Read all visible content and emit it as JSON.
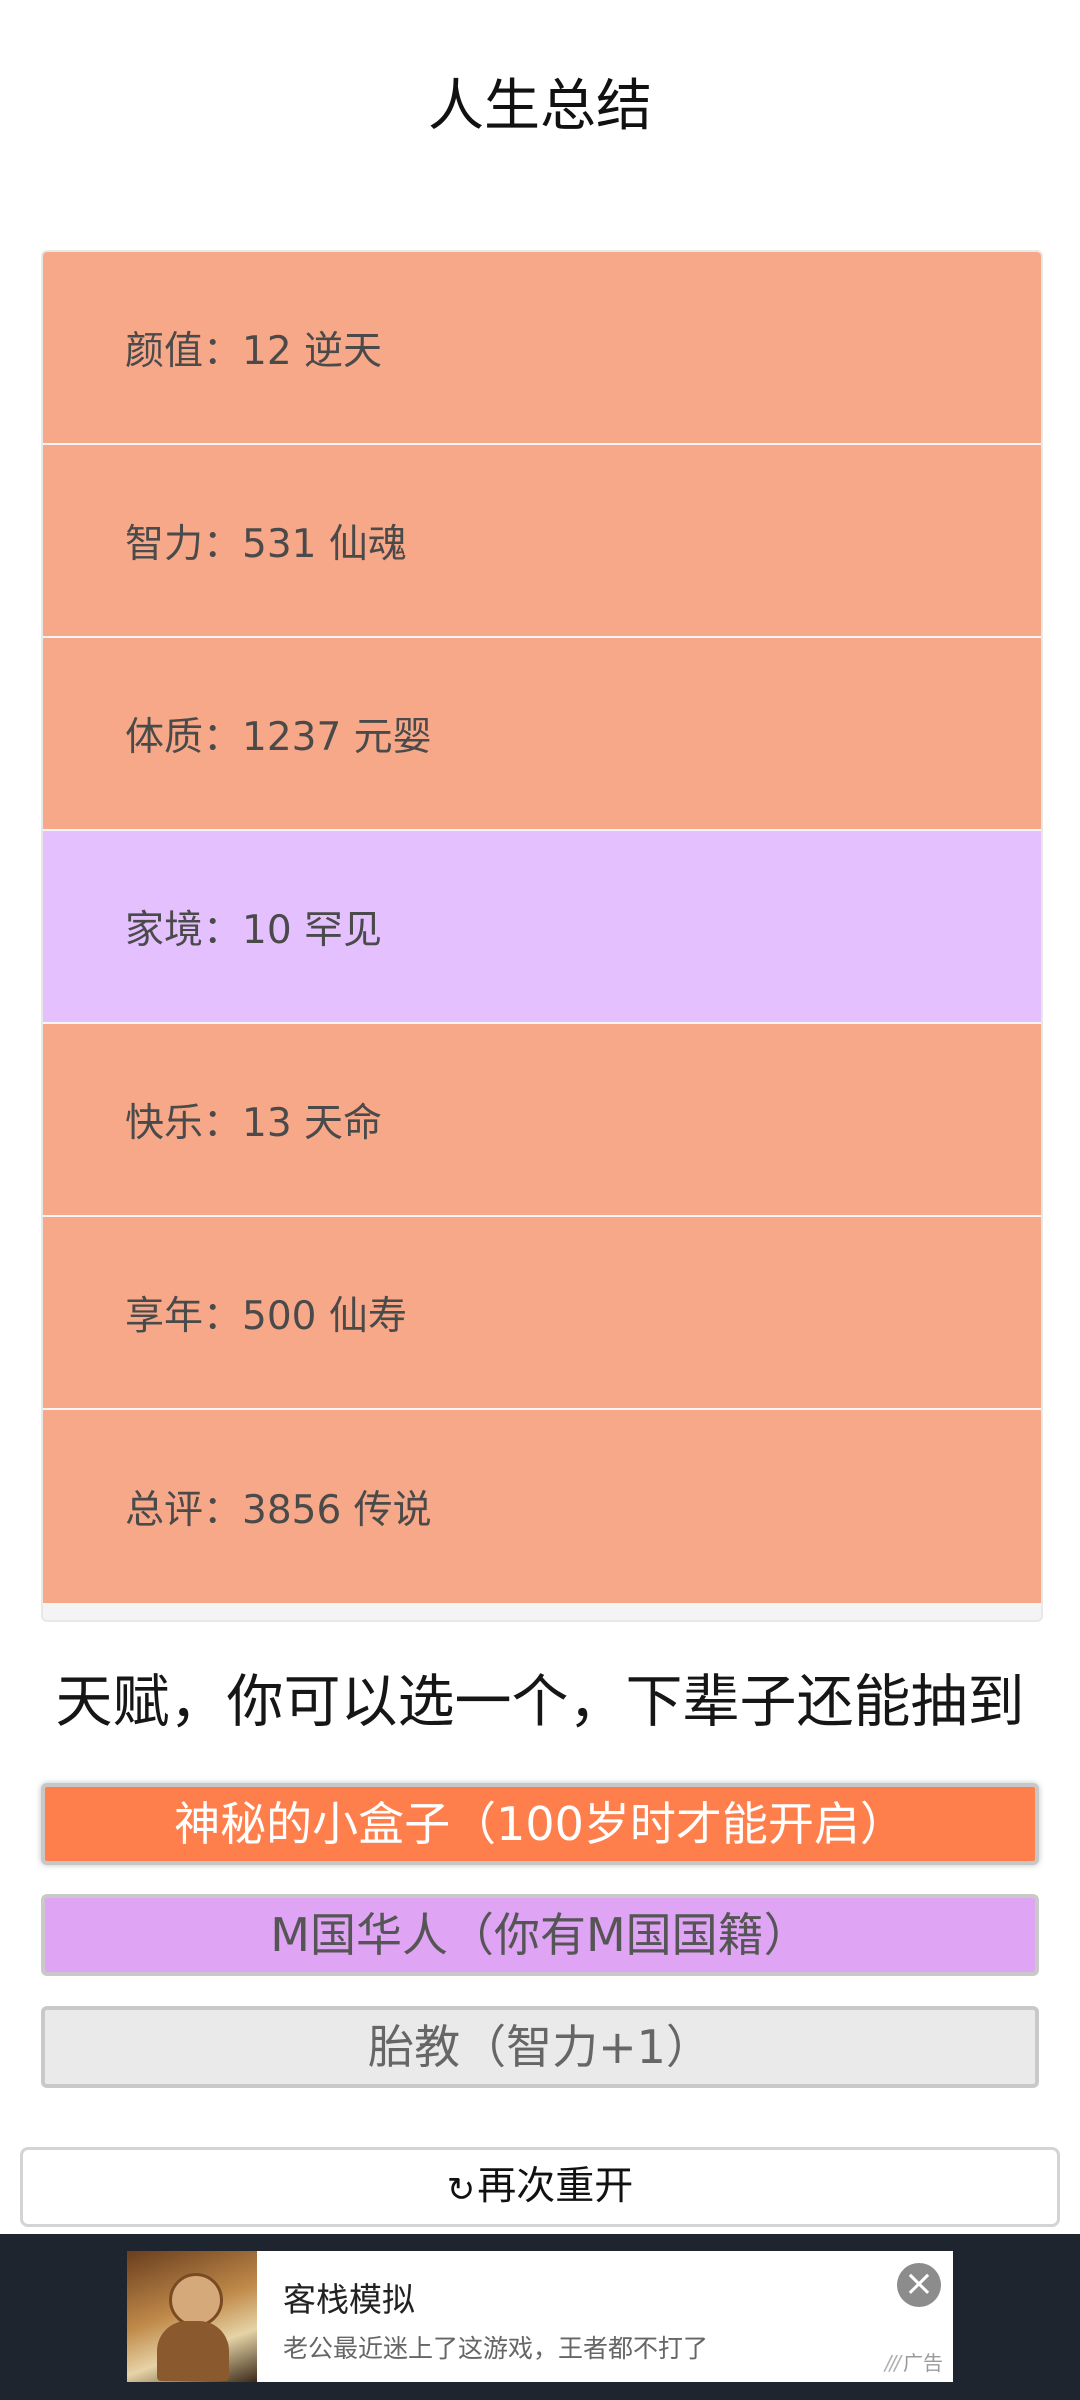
{
  "page": {
    "title": "人生总结"
  },
  "summary": {
    "rows": [
      {
        "label": "颜值：12 逆天",
        "color": "#f7a888"
      },
      {
        "label": "智力：531 仙魂",
        "color": "#f7a888"
      },
      {
        "label": "体质：1237 元婴",
        "color": "#f7a888"
      },
      {
        "label": "家境：10 罕见",
        "color": "#e5c0fe"
      },
      {
        "label": "快乐：13 天命",
        "color": "#f7a888"
      },
      {
        "label": "享年：500 仙寿",
        "color": "#f7a888"
      },
      {
        "label": "总评：3856 传说",
        "color": "#f7a888"
      }
    ]
  },
  "talents": {
    "heading": "天赋，你可以选一个，下辈子还能抽到",
    "options": [
      {
        "label": "神秘的小盒子（100岁时才能开启）",
        "color": "#ff7f4c",
        "selected": true
      },
      {
        "label": "M国华人（你有M国国籍）",
        "color": "#e0a4f5",
        "selected": false
      },
      {
        "label": "胎教（智力+1）",
        "color": "#eaeaea",
        "selected": false
      }
    ]
  },
  "restart": {
    "icon": "refresh-icon",
    "label": "再次重开"
  },
  "ad": {
    "title": "客栈模拟",
    "description": "老公最近迷上了这游戏，王者都不打了",
    "tag": "广告",
    "close_icon": "close-icon"
  }
}
